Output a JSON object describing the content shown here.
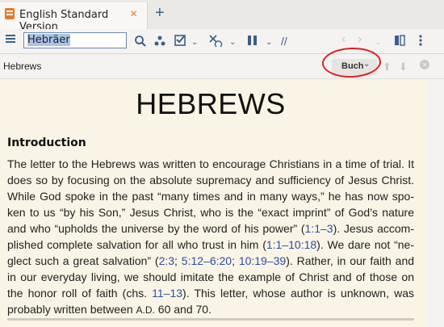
{
  "tab": {
    "title": "English Standard Version",
    "close": "×",
    "add": "+"
  },
  "toolbar": {
    "reference_value": "Hebräer",
    "search_icon": "search-icon",
    "parallel_icon": "three-dots-icon",
    "check_icon": "check-icon",
    "interlinear_icon": "interlinear-icon",
    "columns_icon": "columns-icon",
    "slashes_label": "//"
  },
  "header": {
    "title": "Hebrews",
    "buch_label": "Buch",
    "buch_chevron": "⌄"
  },
  "content": {
    "book_title": "HEBREWS",
    "intro_heading": "Introduction",
    "p1": "The letter to the Hebrews was written to encourage Christians in a time of trial. It does so by focusing on the absolute supremacy and sufficiency of Jesus Christ. While God spoke in the past “many times and in many ways,” he has now spo­ken to us “by his Son,” Jesus Christ, who is the “exact imprint” of God’s nature and who “upholds the universe by the word of his power” (",
    "ref1": "1:1–3",
    "p2": "). Jesus accom­plished complete salvation for all who trust in him (",
    "ref2": "1:1–10:18",
    "p3": "). We dare not “ne­glect such a great salvation” (",
    "ref3": "2:3",
    "p4": "; ",
    "ref4": "5:12–6:20",
    "p5": "; ",
    "ref5": "10:19–39",
    "p6": "). Rather, in our faith and in our everyday living, we should imitate the example of Christ and of those on the honor roll of faith (chs. ",
    "ref6": "11–13",
    "p7": "). This letter, whose author is unknown, was probably written between ",
    "era": "A.D.",
    "p8": " 60 and 70."
  },
  "colors": {
    "accent": "#3a5f8a",
    "highlight_circle": "#e01f1f",
    "page_bg": "#faf4e6",
    "link": "#2c4fa3"
  }
}
